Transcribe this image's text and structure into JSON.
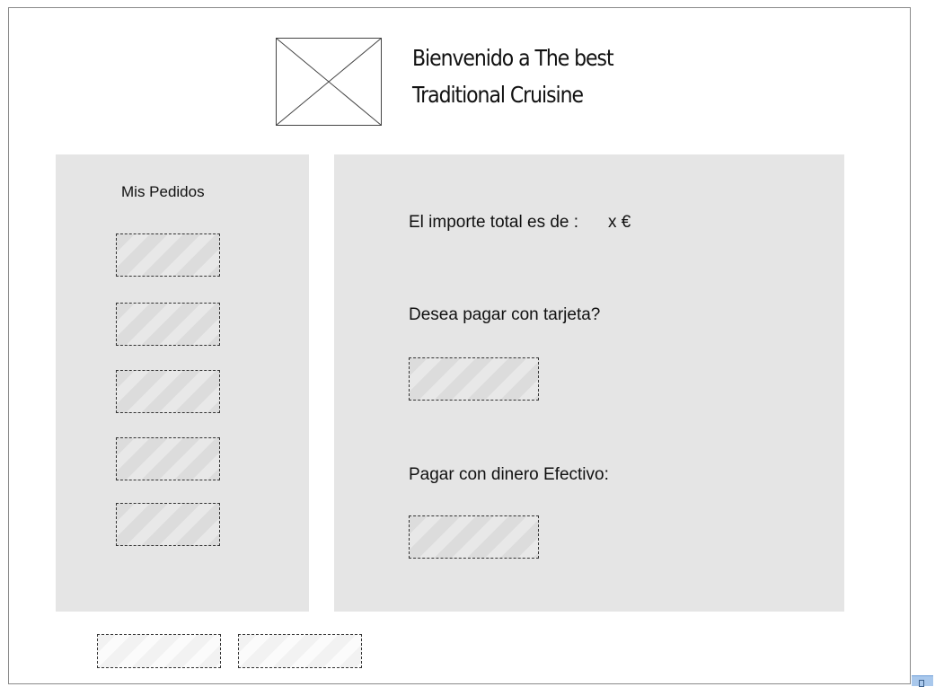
{
  "header": {
    "logo_icon": "image-placeholder-icon",
    "title_line1": "Bienvenido a The best",
    "title_line2": "Traditional Cruisine"
  },
  "orders_panel": {
    "title": "Mis Pedidos",
    "item_count": 5
  },
  "payment_panel": {
    "amount_label": "El importe total es de :",
    "amount_value": "x €",
    "card_question": "Desea pagar con tarjeta?",
    "cash_label": "Pagar con dinero Efectivo:"
  },
  "colors": {
    "panel_background": "#e5e5e5",
    "placeholder_fill": "#dcdcdc",
    "frame_border": "#8a8a8a",
    "corner_handle": "#a9c8ec"
  }
}
